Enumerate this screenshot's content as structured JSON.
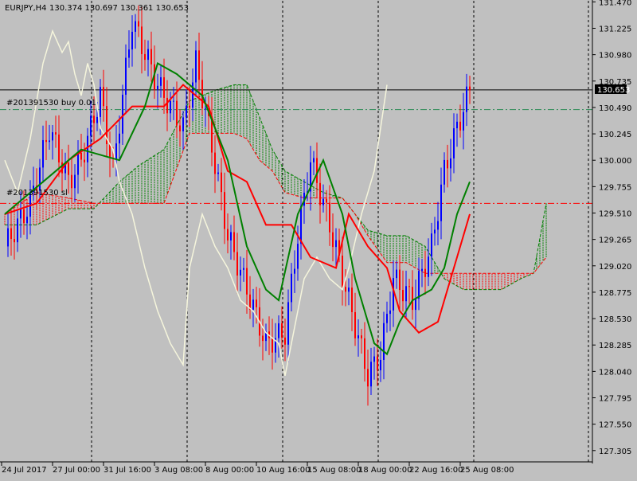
{
  "header": {
    "symbol": "EURJPY,H4",
    "ohlc": "130.374 130.697 130.361 130.653"
  },
  "current_price_label": "130.653",
  "order_labels": {
    "buy": "#201391530 buy 0.01",
    "sl": "#201391530 sl"
  },
  "colors": {
    "background": "#c0c0c0",
    "bull_candle": "#0000ff",
    "bear_candle": "#ff0000",
    "kijun": "#ff0000",
    "tenkan": "#008000",
    "chikou": "#f5f5dc",
    "cloud_bull": "#008000",
    "cloud_bear": "#ff0000",
    "buy_line": "#2e8b57",
    "sl_line": "#ff0000",
    "vgrid": "#000000"
  },
  "chart_data": {
    "type": "candlestick",
    "title": "EURJPY,H4",
    "xlabel": "",
    "ylabel": "",
    "ylim": [
      127.2,
      131.48
    ],
    "x_tick_labels": [
      "24 Jul 2017",
      "27 Jul 00:00",
      "31 Jul 16:00",
      "3 Aug 08:00",
      "8 Aug 00:00",
      "10 Aug 16:00",
      "15 Aug 08:00",
      "18 Aug 00:00",
      "22 Aug 16:00",
      "25 Aug 08:00"
    ],
    "y_tick_labels": [
      "131.470",
      "131.225",
      "130.980",
      "130.735",
      "130.490",
      "130.245",
      "130.000",
      "129.755",
      "129.510",
      "129.265",
      "129.020",
      "128.775",
      "128.530",
      "128.285",
      "128.040",
      "127.795",
      "127.550",
      "127.305"
    ],
    "y_tick_values": [
      131.47,
      131.225,
      130.98,
      130.735,
      130.49,
      130.245,
      130.0,
      129.755,
      129.51,
      129.265,
      129.02,
      128.775,
      128.53,
      128.285,
      128.04,
      127.795,
      127.55,
      127.305
    ],
    "last_price": 130.653,
    "buy_price": 130.47,
    "sl_price": 129.6,
    "grid": "vertical-dotted",
    "anchors": [
      [
        0,
        129.2
      ],
      [
        8,
        129.6
      ],
      [
        14,
        130.3
      ],
      [
        20,
        129.8
      ],
      [
        24,
        130.0
      ],
      [
        30,
        130.6
      ],
      [
        34,
        129.9
      ],
      [
        40,
        131.3
      ],
      [
        48,
        130.7
      ],
      [
        56,
        130.3
      ],
      [
        60,
        130.9
      ],
      [
        64,
        130.3
      ],
      [
        70,
        129.3
      ],
      [
        76,
        128.8
      ],
      [
        82,
        128.3
      ],
      [
        88,
        128.4
      ],
      [
        92,
        129.3
      ],
      [
        96,
        130.0
      ],
      [
        102,
        129.4
      ],
      [
        108,
        128.7
      ],
      [
        114,
        128.0
      ],
      [
        118,
        128.2
      ],
      [
        122,
        128.9
      ],
      [
        128,
        128.7
      ],
      [
        134,
        129.2
      ],
      [
        138,
        129.9
      ],
      [
        142,
        130.3
      ],
      [
        146,
        130.653
      ]
    ],
    "tenkan": [
      [
        0,
        129.5
      ],
      [
        12,
        129.8
      ],
      [
        24,
        130.1
      ],
      [
        36,
        130.0
      ],
      [
        44,
        130.5
      ],
      [
        48,
        130.9
      ],
      [
        54,
        130.8
      ],
      [
        62,
        130.6
      ],
      [
        70,
        130.0
      ],
      [
        76,
        129.2
      ],
      [
        82,
        128.8
      ],
      [
        86,
        128.7
      ],
      [
        92,
        129.5
      ],
      [
        100,
        130.0
      ],
      [
        106,
        129.5
      ],
      [
        110,
        128.9
      ],
      [
        116,
        128.3
      ],
      [
        120,
        128.2
      ],
      [
        124,
        128.5
      ],
      [
        128,
        128.7
      ],
      [
        134,
        128.8
      ],
      [
        138,
        129.0
      ],
      [
        142,
        129.5
      ],
      [
        146,
        129.8
      ]
    ],
    "kijun": [
      [
        0,
        129.5
      ],
      [
        10,
        129.6
      ],
      [
        20,
        130.0
      ],
      [
        30,
        130.2
      ],
      [
        40,
        130.5
      ],
      [
        50,
        130.5
      ],
      [
        56,
        130.7
      ],
      [
        64,
        130.5
      ],
      [
        70,
        129.9
      ],
      [
        76,
        129.8
      ],
      [
        82,
        129.4
      ],
      [
        90,
        129.4
      ],
      [
        96,
        129.1
      ],
      [
        104,
        129.0
      ],
      [
        108,
        129.5
      ],
      [
        114,
        129.2
      ],
      [
        120,
        129.0
      ],
      [
        124,
        128.6
      ],
      [
        130,
        128.4
      ],
      [
        136,
        128.5
      ],
      [
        140,
        128.9
      ],
      [
        146,
        129.5
      ]
    ],
    "chikou": [
      [
        0,
        130.0
      ],
      [
        4,
        129.7
      ],
      [
        8,
        130.2
      ],
      [
        12,
        130.9
      ],
      [
        15,
        131.2
      ],
      [
        18,
        131.0
      ],
      [
        20,
        131.1
      ],
      [
        22,
        130.8
      ],
      [
        24,
        130.6
      ],
      [
        26,
        130.9
      ],
      [
        28,
        130.7
      ],
      [
        30,
        130.3
      ],
      [
        34,
        130.1
      ],
      [
        36,
        129.8
      ],
      [
        40,
        129.5
      ],
      [
        44,
        129.0
      ],
      [
        48,
        128.6
      ],
      [
        52,
        128.3
      ],
      [
        56,
        128.1
      ],
      [
        58,
        129.0
      ],
      [
        62,
        129.5
      ],
      [
        66,
        129.2
      ],
      [
        70,
        129.0
      ],
      [
        74,
        128.7
      ],
      [
        78,
        128.6
      ],
      [
        82,
        128.4
      ],
      [
        86,
        128.3
      ],
      [
        88,
        128.0
      ],
      [
        90,
        128.3
      ],
      [
        94,
        128.9
      ],
      [
        98,
        129.1
      ],
      [
        102,
        128.9
      ],
      [
        106,
        128.8
      ],
      [
        108,
        129.0
      ],
      [
        112,
        129.5
      ],
      [
        116,
        129.9
      ],
      [
        120,
        130.7
      ]
    ],
    "senkou_a": [
      [
        0,
        129.4
      ],
      [
        10,
        129.4
      ],
      [
        20,
        129.55
      ],
      [
        28,
        129.55
      ],
      [
        36,
        129.8
      ],
      [
        42,
        129.95
      ],
      [
        50,
        130.1
      ],
      [
        58,
        130.55
      ],
      [
        66,
        130.65
      ],
      [
        72,
        130.7
      ],
      [
        76,
        130.7
      ],
      [
        80,
        130.4
      ],
      [
        84,
        130.1
      ],
      [
        88,
        129.9
      ],
      [
        94,
        129.8
      ],
      [
        100,
        129.7
      ],
      [
        106,
        129.65
      ],
      [
        110,
        129.5
      ],
      [
        114,
        129.35
      ],
      [
        120,
        129.3
      ],
      [
        126,
        129.3
      ],
      [
        132,
        129.2
      ],
      [
        138,
        128.9
      ],
      [
        144,
        128.8
      ],
      [
        150,
        128.8
      ],
      [
        156,
        128.8
      ],
      [
        162,
        128.9
      ],
      [
        166,
        128.95
      ],
      [
        170,
        129.6
      ]
    ],
    "senkou_b": [
      [
        0,
        129.5
      ],
      [
        10,
        129.7
      ],
      [
        20,
        129.65
      ],
      [
        28,
        129.6
      ],
      [
        36,
        129.6
      ],
      [
        42,
        129.6
      ],
      [
        50,
        129.6
      ],
      [
        58,
        130.25
      ],
      [
        66,
        130.25
      ],
      [
        72,
        130.25
      ],
      [
        76,
        130.2
      ],
      [
        80,
        130.0
      ],
      [
        84,
        129.9
      ],
      [
        88,
        129.7
      ],
      [
        94,
        129.65
      ],
      [
        100,
        129.65
      ],
      [
        106,
        129.65
      ],
      [
        110,
        129.5
      ],
      [
        114,
        129.3
      ],
      [
        120,
        129.05
      ],
      [
        126,
        129.05
      ],
      [
        132,
        128.95
      ],
      [
        138,
        128.95
      ],
      [
        144,
        128.95
      ],
      [
        150,
        128.95
      ],
      [
        156,
        128.95
      ],
      [
        162,
        128.95
      ],
      [
        166,
        128.95
      ],
      [
        170,
        129.1
      ]
    ]
  }
}
